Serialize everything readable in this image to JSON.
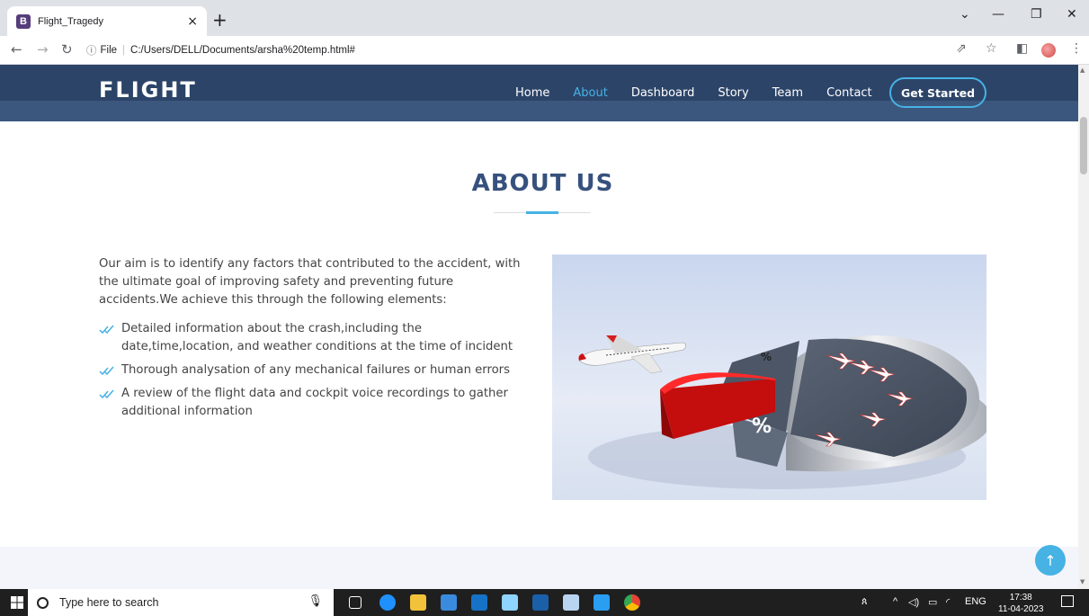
{
  "browser": {
    "tab_title": "Flight_Tragedy",
    "tab_favicon": "B",
    "tab_close": "×",
    "new_tab": "+",
    "url_scheme_label": "File",
    "url": "C:/Users/DELL/Documents/arsha%20temp.html#",
    "icons": [
      "back-arrow-icon",
      "forward-arrow-icon",
      "reload-icon",
      "info-icon",
      "share-icon",
      "star-icon",
      "sidebar-icon",
      "profile-avatar",
      "kebab-menu-icon",
      "minimize-icon",
      "restore-icon",
      "close-icon",
      "tab-search-icon"
    ]
  },
  "site": {
    "logo": "FLIGHT",
    "nav": [
      {
        "label": "Home",
        "active": false
      },
      {
        "label": "About",
        "active": true
      },
      {
        "label": "Dashboard",
        "active": false
      },
      {
        "label": "Story",
        "active": false
      },
      {
        "label": "Team",
        "active": false
      },
      {
        "label": "Contact",
        "active": false
      }
    ],
    "cta": "Get Started",
    "accent_color": "#47b2e4",
    "header_color": "#2c4468",
    "title_color": "#37517e"
  },
  "about": {
    "title": "ABOUT US",
    "intro": "Our aim is to identify any factors that contributed to the accident, with the ultimate goal of improving safety and preventing future accidents.We achieve this through the following elements:",
    "items": [
      "Detailed information about the crash,including the date,time,location, and weather conditions at the time of incident",
      "Thorough analysation of any mechanical failures or human errors",
      "A review of the flight data and cockpit voice recordings to gather additional information"
    ],
    "image_description_icon": "plane-pie-chart-illustration"
  },
  "back_to_top": "↑",
  "taskbar": {
    "search_placeholder": "Type here to search",
    "time": "17:38",
    "date": "11-04-2023",
    "language": "ENG"
  }
}
